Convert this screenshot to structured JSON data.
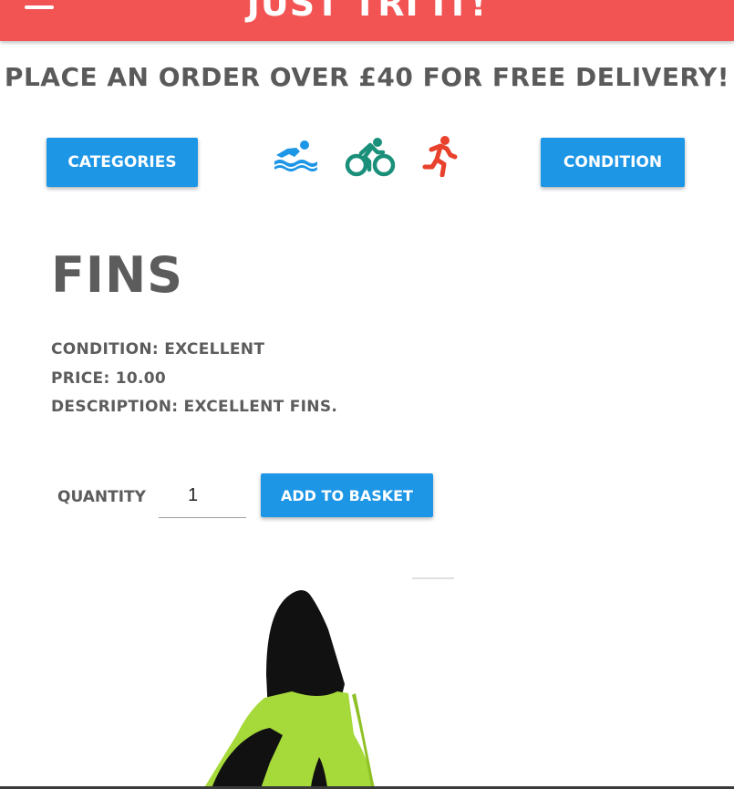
{
  "header": {
    "brand": "Just Tri It!",
    "menu_icon": "hamburger-menu-icon",
    "background_color": "#f25454"
  },
  "promo": {
    "text": "Place an order over £40 for free delivery!"
  },
  "filters": {
    "categories_label": "Categories",
    "condition_label": "Condition",
    "sport_icons": [
      {
        "name": "swim-icon",
        "color": "#1e96e6"
      },
      {
        "name": "bike-icon",
        "color": "#1a8f7a"
      },
      {
        "name": "run-icon",
        "color": "#e8412c"
      }
    ]
  },
  "product": {
    "title": "Fins",
    "condition": "Condition: Excellent",
    "price": "Price: 10.00",
    "description": "Description: Excellent fins.",
    "image_icon": "fins-image"
  },
  "order": {
    "quantity_label": "Quantity",
    "quantity_value": "1",
    "add_button_label": "Add to basket"
  },
  "colors": {
    "accent": "#1e96e6",
    "text": "#5c5c5c",
    "fin_green": "#a6d93a",
    "fin_black": "#111111"
  }
}
